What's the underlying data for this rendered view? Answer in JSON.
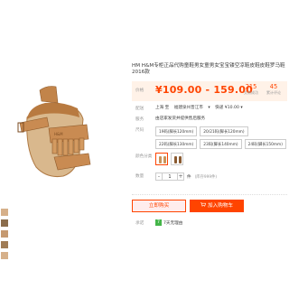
{
  "product": {
    "title": "HM H&M专柜正品代购童鞋男女童男女宝宝镂空凉鞋皮鞋皮鞋罗马鞋 2016款"
  },
  "price": {
    "label": "价格",
    "value": "¥109.00 - 159.00",
    "sales_count": "215",
    "sales_label": "交易成功",
    "review_count": "45",
    "review_label": "累计评论"
  },
  "shipping": {
    "label": "配送",
    "from": "上海 至",
    "to": "福建泉州晋江市",
    "dropdown": "▾",
    "fee": "快递 ¥10.00 ▾"
  },
  "service": {
    "label": "服务",
    "text": "由店家发货并提供售后服务"
  },
  "size": {
    "label": "尺码",
    "options": [
      "19码(脚长120mm)",
      "20/21码(脚长120mm)",
      "22码(脚长130mm)",
      "23码(脚长140mm)",
      "24码(脚长150mm)"
    ]
  },
  "color": {
    "label": "颜色分类",
    "swatches": [
      "shoe-brown-icon",
      "shoe-dark-icon"
    ]
  },
  "quantity": {
    "label": "数量",
    "minus": "-",
    "value": "1",
    "plus": "+",
    "unit": "件",
    "stock": "(库存999件)"
  },
  "actions": {
    "buy_now": "立即购买",
    "add_cart": "加入购物车"
  },
  "promise": {
    "label": "承诺",
    "badge": "7",
    "text": "7天无理由"
  },
  "colors": {
    "accent": "#ff4400",
    "accent_light": "#ffeded",
    "price_bg": "#fff2e8",
    "shoe_tan": "#c8945a"
  }
}
